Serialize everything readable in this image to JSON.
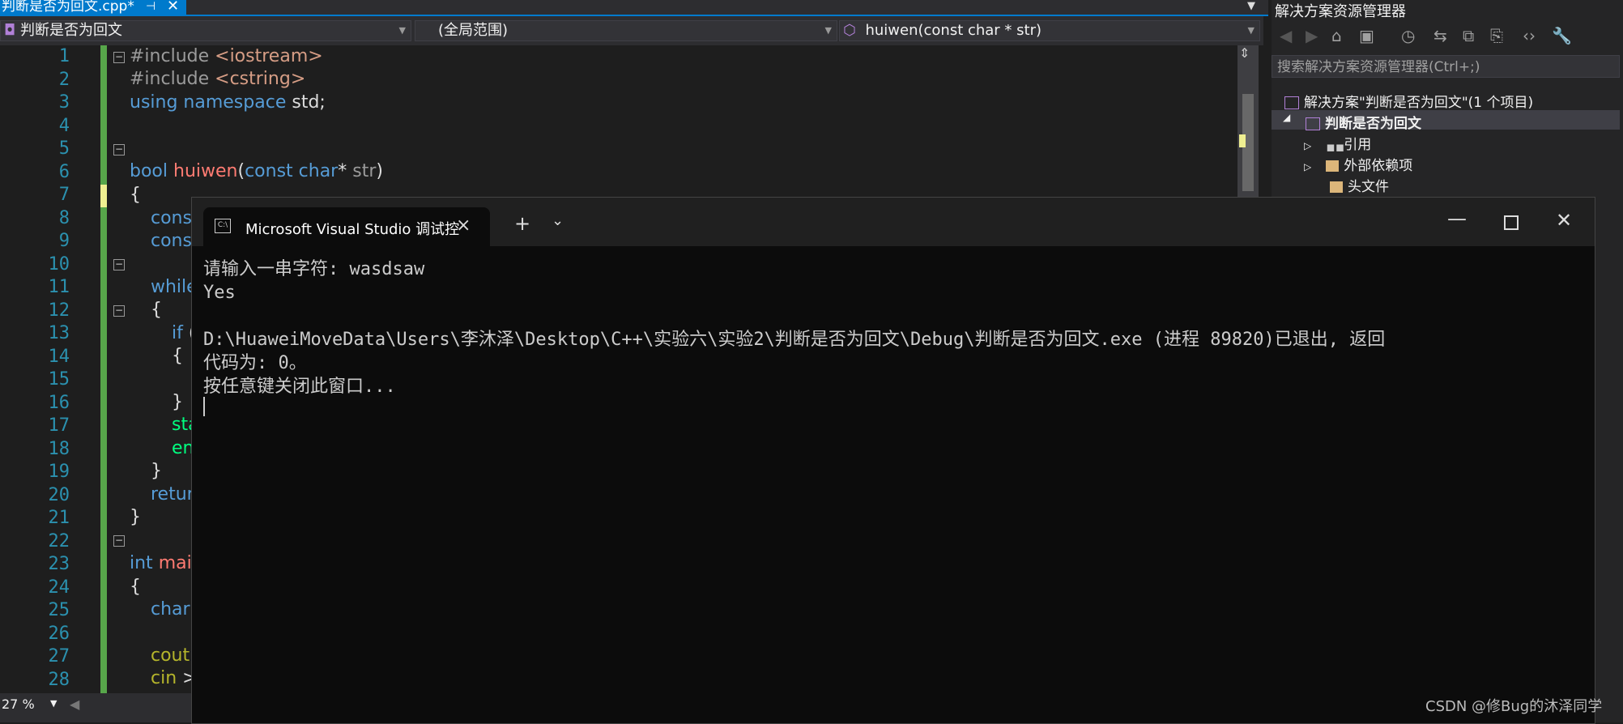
{
  "tab": {
    "title": "判断是否为回文.cpp*",
    "pin": "⊣",
    "close": "✕"
  },
  "navbar": {
    "project": "判断是否为回文",
    "scope": "(全局范围)",
    "member": "huiwen(const char * str)"
  },
  "editor": {
    "line_numbers": [
      "1",
      "2",
      "3",
      "4",
      "5",
      "6",
      "7",
      "8",
      "9",
      "10",
      "11",
      "12",
      "13",
      "14",
      "15",
      "16",
      "17",
      "18",
      "19",
      "20",
      "21",
      "22",
      "23",
      "24",
      "25",
      "26",
      "27",
      "28"
    ],
    "zoom": "27 %"
  },
  "solution_explorer": {
    "title": "解决方案资源管理器",
    "search_placeholder": "搜索解决方案资源管理器(Ctrl+;)",
    "solution_label": "解决方案\"判断是否为回文\"(1 个项目)",
    "project_label": "判断是否为回文",
    "items": [
      "引用",
      "外部依赖项",
      "头文件"
    ]
  },
  "console": {
    "tab_title": "Microsoft Visual Studio 调试控",
    "lines": [
      "请输入一串字符: wasdsaw",
      "Yes",
      "",
      "D:\\HuaweiMoveData\\Users\\李沐泽\\Desktop\\C++\\实验六\\实验2\\判断是否为回文\\Debug\\判断是否为回文.exe (进程 89820)已退出, 返回",
      "代码为: 0。",
      "按任意键关闭此窗口..."
    ]
  },
  "watermark": "CSDN @修Bug的沐泽同学"
}
